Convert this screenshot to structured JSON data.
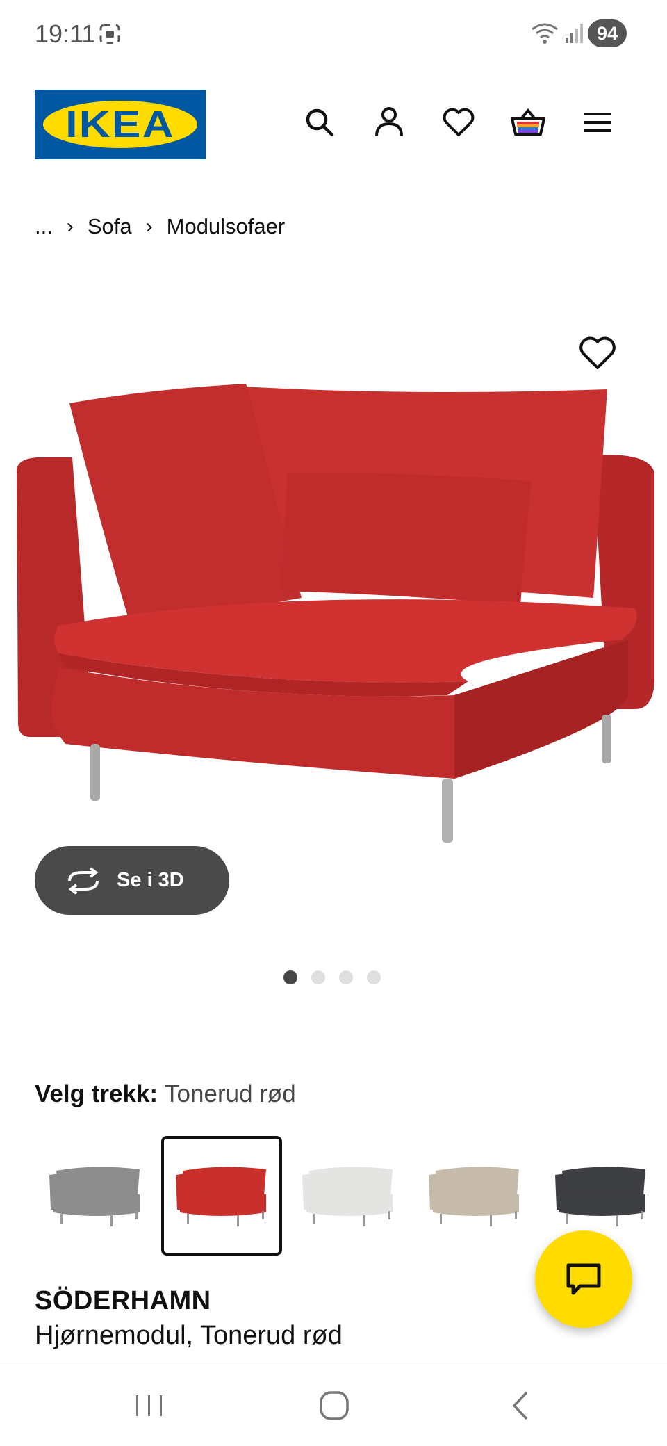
{
  "status": {
    "time": "19:11",
    "battery": "94"
  },
  "header": {
    "logo_text": "IKEA"
  },
  "breadcrumb": {
    "ellipsis": "...",
    "items": [
      "Sofa",
      "Modulsofaer"
    ]
  },
  "gallery": {
    "btn_3d_label": "Se i 3D",
    "slide_count": 4,
    "active_slide": 1
  },
  "variant": {
    "label": "Velg trekk:",
    "value": "Tonerud rød",
    "swatch_colors": [
      "#8d8d8d",
      "#c9302c",
      "#e4e4e2",
      "#c6bbab",
      "#3e3f42"
    ],
    "selected_index": 1
  },
  "product": {
    "name": "SÖDERHAMN",
    "description": "Hjørnemodul, Tonerud rød"
  },
  "colors": {
    "brand_blue": "#0058a3",
    "brand_yellow": "#ffdb00",
    "sofa_red": "#c9302c"
  }
}
